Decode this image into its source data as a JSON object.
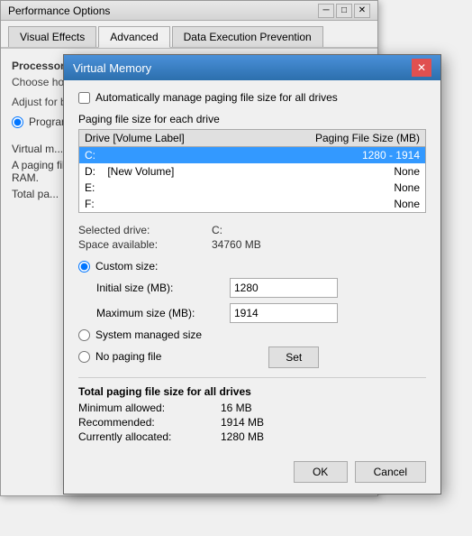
{
  "perfOptions": {
    "titleBar": {
      "title": "Performance Options",
      "minimizeBtn": "─",
      "maximizeBtn": "□",
      "closeBtn": "✕"
    },
    "tabs": [
      {
        "label": "Visual Effects",
        "active": false
      },
      {
        "label": "Advanced",
        "active": true
      },
      {
        "label": "Data Execution Prevention",
        "active": false
      }
    ],
    "content": {
      "processorSection": "Processor scheduling",
      "chooseText": "Choose how to allocate processor resources.",
      "adjustText": "Adjust for best performance of:",
      "radioPrograms": "Programs",
      "virtualSection": "Virtual m...",
      "pagingText": "A paging file is an area on the hard disk that Windows uses as if it were RAM.",
      "totalText": "Total pa..."
    }
  },
  "vmDialog": {
    "titleBar": {
      "title": "Virtual Memory",
      "closeBtn": "✕"
    },
    "autoManageLabel": "Automatically manage paging file size for all drives",
    "pagingLabel": "Paging file size for each drive",
    "tableHeader": {
      "driveCol": "Drive  [Volume Label]",
      "pagingCol": "Paging File Size (MB)"
    },
    "drives": [
      {
        "drive": "C:",
        "label": "",
        "paging": "1280 - 1914",
        "selected": true
      },
      {
        "drive": "D:",
        "label": "    [New Volume]",
        "paging": "None",
        "selected": false
      },
      {
        "drive": "E:",
        "label": "",
        "paging": "None",
        "selected": false
      },
      {
        "drive": "F:",
        "label": "",
        "paging": "None",
        "selected": false
      }
    ],
    "selectedDriveLabel": "Selected drive:",
    "selectedDriveValue": "C:",
    "spaceAvailableLabel": "Space available:",
    "spaceAvailableValue": "34760 MB",
    "customSizeLabel": "Custom size:",
    "initialSizeLabel": "Initial size (MB):",
    "initialSizeValue": "1280",
    "maxSizeLabel": "Maximum size (MB):",
    "maxSizeValue": "1914",
    "systemManagedLabel": "System managed size",
    "noPagingLabel": "No paging file",
    "setBtn": "Set",
    "totalSection": {
      "title": "Total paging file size for all drives",
      "minAllowedLabel": "Minimum allowed:",
      "minAllowedValue": "16 MB",
      "recommendedLabel": "Recommended:",
      "recommendedValue": "1914 MB",
      "currentlyAllocatedLabel": "Currently allocated:",
      "currentlyAllocatedValue": "1280 MB"
    },
    "buttons": {
      "ok": "OK",
      "cancel": "Cancel"
    }
  }
}
